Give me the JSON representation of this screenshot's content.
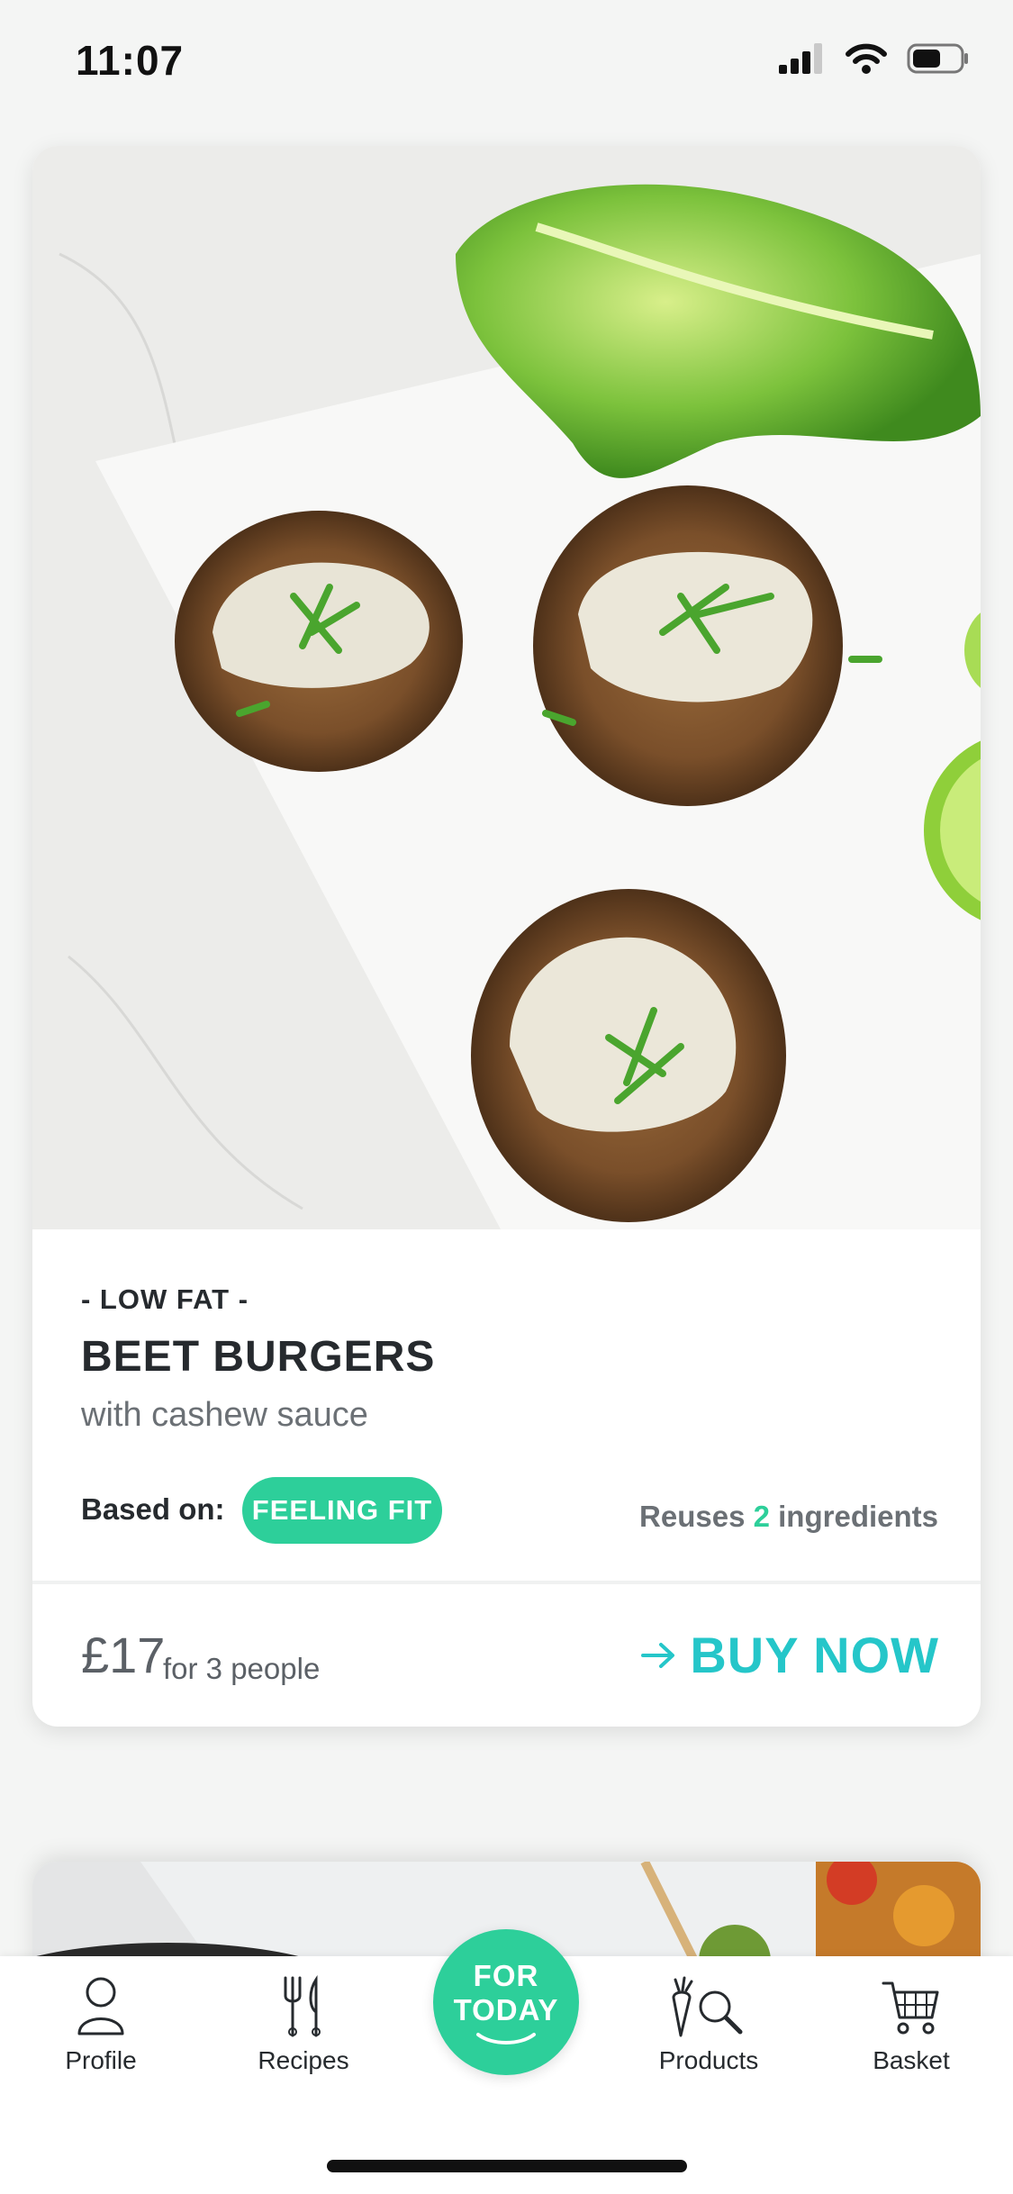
{
  "status_bar": {
    "time": "11:07"
  },
  "recipe_card": {
    "tag": "- LOW FAT -",
    "title": "BEET BURGERS",
    "subtitle": "with cashew sauce",
    "based_on_label": "Based on:",
    "badge": "FEELING FIT",
    "reuses_prefix": "Reuses",
    "reuses_count": "2",
    "reuses_suffix": "ingredients",
    "price": "£17",
    "per_people": "for 3 people",
    "buy_label": "BUY NOW"
  },
  "tab_bar": {
    "items": [
      {
        "label": "Profile",
        "icon": "person-icon"
      },
      {
        "label": "Recipes",
        "icon": "fork-knife-icon"
      },
      {
        "label": "Products",
        "icon": "carrot-search-icon"
      },
      {
        "label": "Basket",
        "icon": "cart-icon"
      }
    ],
    "center_button": {
      "line1": "FOR",
      "line2": "TODAY"
    }
  },
  "colors": {
    "accent_green": "#2dcf9a",
    "accent_teal": "#25c6c9",
    "text_dark": "#262a2e",
    "text_gray": "#6b7075"
  }
}
